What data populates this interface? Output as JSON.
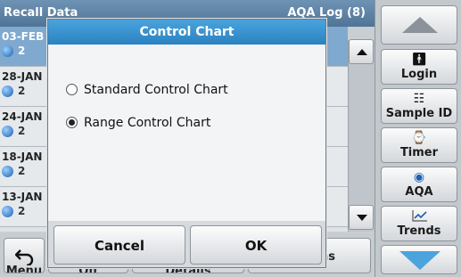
{
  "app": {
    "title_left": "Recall Data",
    "title_right": "AQA Log (8)"
  },
  "rows": [
    {
      "date": "03-FEB",
      "num": "2",
      "selected": true
    },
    {
      "date": "28-JAN",
      "num": "2"
    },
    {
      "date": "24-JAN",
      "num": "2"
    },
    {
      "date": "18-JAN",
      "num": "2"
    },
    {
      "date": "13-JAN",
      "num": "2"
    }
  ],
  "bottom_bar": {
    "buttons": [
      "Menu",
      "Off",
      "Details",
      "Options"
    ]
  },
  "side_panel": {
    "login": "Login",
    "sample_id": "Sample ID",
    "timer": "Timer",
    "aqa": "AQA",
    "trends": "Trends"
  },
  "dialog": {
    "title": "Control Chart",
    "options": [
      {
        "label": "Standard Control Chart",
        "checked": false
      },
      {
        "label": "Range Control Chart",
        "checked": true
      }
    ],
    "cancel": "Cancel",
    "ok": "OK"
  },
  "colors": {
    "dialog_title": "#3592cf",
    "selected_row": "#7fa9cf",
    "scroll_down_accent": "#4ba4dd"
  }
}
